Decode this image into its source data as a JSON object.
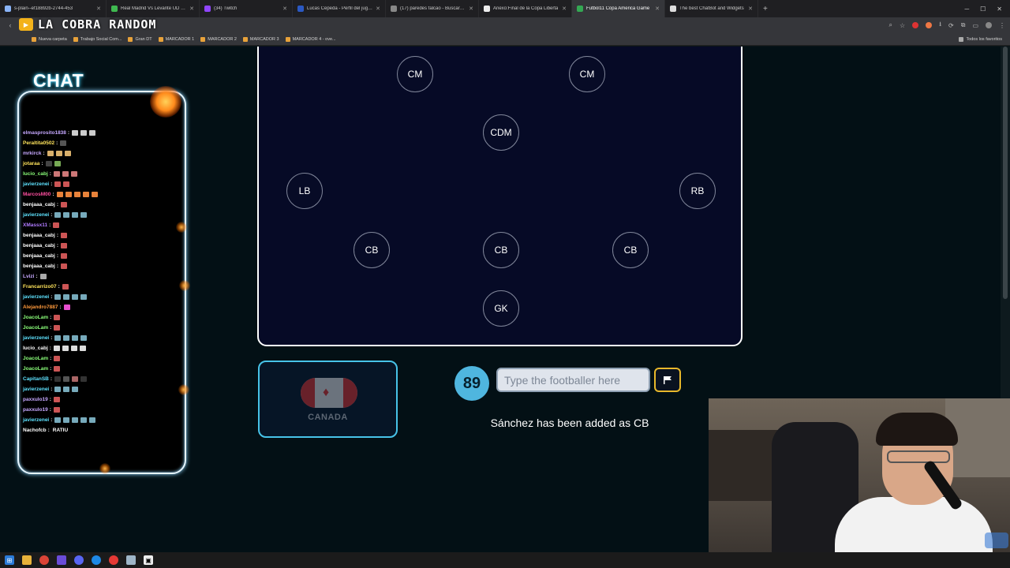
{
  "browser": {
    "tabs": [
      {
        "title": "s-plain--ef18892b-2744-453",
        "color": "#8ab4f8",
        "active": false
      },
      {
        "title": "Real Madrid Vs Levante UD - Al",
        "color": "#3fb950",
        "active": false
      },
      {
        "title": "(34) Twitch",
        "color": "#9146ff",
        "active": false
      },
      {
        "title": "Lucas Cepeda - Perfil del jugad",
        "color": "#2b59c3",
        "active": false
      },
      {
        "title": "(17) paredes falcao - Buscar / X",
        "color": "#888888",
        "active": false
      },
      {
        "title": "Anexo:Final de la Copa Liberta",
        "color": "#eeeeee",
        "active": false
      },
      {
        "title": "Futbol11 Copa America Game",
        "color": "#34a853",
        "active": true
      },
      {
        "title": "The best ChatBot and Widgets",
        "color": "#dddddd",
        "active": false
      }
    ],
    "new_tab": "+",
    "bookmarks": [
      "Nueva carpeta",
      "Trabajo Social Com...",
      "Gran DT",
      "MARCADOR 1",
      "MARCADOR 2",
      "MARCADOR 3",
      "MARCADOR 4 - ove..."
    ],
    "bookmarks_right": "Todos los favoritos"
  },
  "stream": {
    "brand": "LA COBRA RANDOM",
    "chat_title": "CHAT",
    "chat": [
      {
        "user": "elmasprosito1838",
        "color": "#c6a8ff",
        "emotes": [
          "#ccc",
          "#ccc",
          "#ccc"
        ],
        "text": ""
      },
      {
        "user": "Peraltita0502",
        "color": "#ffe45c",
        "emotes": [
          "#555"
        ],
        "text": ""
      },
      {
        "user": "mrkirck",
        "color": "#c6a8ff",
        "emotes": [
          "#d9b06b",
          "#d9b06b",
          "#d9b06b"
        ],
        "text": ""
      },
      {
        "user": "jotaraa",
        "color": "#ffe45c",
        "emotes": [
          "#444",
          "#7a5"
        ],
        "text": ""
      },
      {
        "user": "lucio_cabj",
        "color": "#8bff7a",
        "emotes": [
          "#c77",
          "#c77",
          "#c77"
        ],
        "text": ""
      },
      {
        "user": "javierzenei",
        "color": "#5ee3ff",
        "emotes": [
          "#c55",
          "#c55"
        ],
        "text": ""
      },
      {
        "user": "MarcosM00",
        "color": "#ff4fa0",
        "emotes": [
          "#e8823a",
          "#e8823a",
          "#e8823a",
          "#e8823a",
          "#e8823a"
        ],
        "text": ""
      },
      {
        "user": "benjaaa_cabj",
        "color": "#ffffff",
        "emotes": [
          "#c55"
        ],
        "text": ""
      },
      {
        "user": "javierzenei",
        "color": "#5ee3ff",
        "emotes": [
          "#7ab",
          "#7ab",
          "#7ab",
          "#7ab"
        ],
        "text": ""
      },
      {
        "user": "XMassx11",
        "color": "#b07bff",
        "emotes": [
          "#c55"
        ],
        "text": ""
      },
      {
        "user": "benjaaa_cabj",
        "color": "#ffffff",
        "emotes": [
          "#c55"
        ],
        "text": ""
      },
      {
        "user": "benjaaa_cabj",
        "color": "#ffffff",
        "emotes": [
          "#c55"
        ],
        "text": ""
      },
      {
        "user": "benjaaa_cabj",
        "color": "#ffffff",
        "emotes": [
          "#c55"
        ],
        "text": ""
      },
      {
        "user": "benjaaa_cabj",
        "color": "#ffffff",
        "emotes": [
          "#c55"
        ],
        "text": ""
      },
      {
        "user": "Lvizi",
        "color": "#c6a8ff",
        "emotes": [
          "#aaa"
        ],
        "text": ""
      },
      {
        "user": "Francarrizo07",
        "color": "#ffe45c",
        "emotes": [
          "#c55"
        ],
        "text": ""
      },
      {
        "user": "javierzenei",
        "color": "#5ee3ff",
        "emotes": [
          "#7ab",
          "#7ab",
          "#7ab",
          "#7ab"
        ],
        "text": ""
      },
      {
        "user": "Alejandro7887",
        "color": "#ff9a3c",
        "emotes": [
          "#e84fd0"
        ],
        "text": ""
      },
      {
        "user": "JoacoLam",
        "color": "#8bff7a",
        "emotes": [
          "#c55"
        ],
        "text": ""
      },
      {
        "user": "JoacoLam",
        "color": "#8bff7a",
        "emotes": [
          "#c55"
        ],
        "text": ""
      },
      {
        "user": "javierzenei",
        "color": "#5ee3ff",
        "emotes": [
          "#7ab",
          "#7ab",
          "#7ab",
          "#7ab"
        ],
        "text": ""
      },
      {
        "user": "lucio_cabj",
        "color": "#ffffff",
        "emotes": [
          "#ddd",
          "#ddd",
          "#ddd",
          "#ddd"
        ],
        "text": ""
      },
      {
        "user": "JoacoLam",
        "color": "#8bff7a",
        "emotes": [
          "#c55"
        ],
        "text": ""
      },
      {
        "user": "JoacoLam",
        "color": "#8bff7a",
        "emotes": [
          "#c55"
        ],
        "text": ""
      },
      {
        "user": "CapitanSB",
        "color": "#5ee3ff",
        "emotes": [
          "#333",
          "#555",
          "#a66",
          "#333"
        ],
        "text": ""
      },
      {
        "user": "javierzenei",
        "color": "#5ee3ff",
        "emotes": [
          "#7ab",
          "#7ab",
          "#7ab"
        ],
        "text": ""
      },
      {
        "user": "paxxulo19",
        "color": "#c6a8ff",
        "emotes": [
          "#c55"
        ],
        "text": ""
      },
      {
        "user": "paxxulo19",
        "color": "#c6a8ff",
        "emotes": [
          "#c55"
        ],
        "text": ""
      },
      {
        "user": "javierzenei",
        "color": "#5ee3ff",
        "emotes": [
          "#7ab",
          "#7ab",
          "#7ab",
          "#7ab",
          "#7ab"
        ],
        "text": ""
      },
      {
        "user": "Nachofcb",
        "color": "#ffffff",
        "emotes": [],
        "text": "RATIU"
      }
    ]
  },
  "game": {
    "positions": [
      {
        "label": "CM",
        "row": "mid"
      },
      {
        "label": "CM",
        "row": "mid"
      },
      {
        "label": "CDM",
        "row": "dm"
      },
      {
        "label": "LB",
        "row": "fb"
      },
      {
        "label": "RB",
        "row": "fb"
      },
      {
        "label": "CB",
        "row": "cb"
      },
      {
        "label": "CB",
        "row": "cb"
      },
      {
        "label": "CB",
        "row": "cb"
      },
      {
        "label": "GK",
        "row": "gk"
      }
    ],
    "country": "CANADA",
    "score": "89",
    "input_placeholder": "Type the footballer here",
    "input_value": "",
    "status_message": "Sánchez has been added as CB"
  }
}
